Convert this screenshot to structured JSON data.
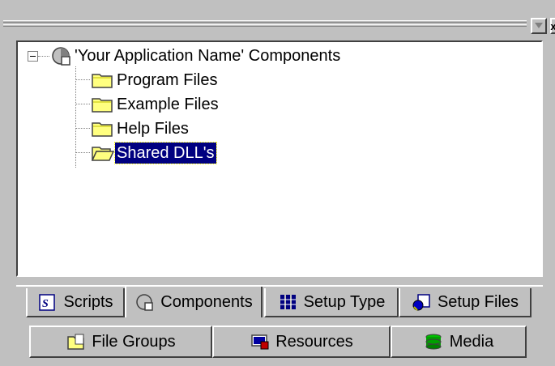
{
  "window": {
    "minimize_icon": "minimize-icon",
    "close_icon": "close-icon",
    "close_label": "x"
  },
  "tree": {
    "root": {
      "label": "'Your Application Name' Components",
      "icon": "components-icon",
      "expanded": true
    },
    "children": [
      {
        "label": "Program Files",
        "icon": "folder-icon",
        "selected": false
      },
      {
        "label": "Example Files",
        "icon": "folder-icon",
        "selected": false
      },
      {
        "label": "Help Files",
        "icon": "folder-icon",
        "selected": false
      },
      {
        "label": "Shared DLL's",
        "icon": "folder-open-icon",
        "selected": true
      }
    ]
  },
  "tabs": {
    "row1": [
      {
        "label": "Scripts",
        "icon": "scripts-icon",
        "active": false
      },
      {
        "label": "Components",
        "icon": "components-icon",
        "active": true
      },
      {
        "label": "Setup Type",
        "icon": "setup-type-icon",
        "active": false
      },
      {
        "label": "Setup Files",
        "icon": "setup-files-icon",
        "active": false
      }
    ],
    "row2": [
      {
        "label": "File Groups",
        "icon": "file-groups-icon",
        "active": false
      },
      {
        "label": "Resources",
        "icon": "resources-icon",
        "active": false
      },
      {
        "label": "Media",
        "icon": "media-icon",
        "active": false
      }
    ]
  },
  "colors": {
    "selection": "#000080",
    "face": "#c0c0c0",
    "folder": "#ffff80"
  }
}
